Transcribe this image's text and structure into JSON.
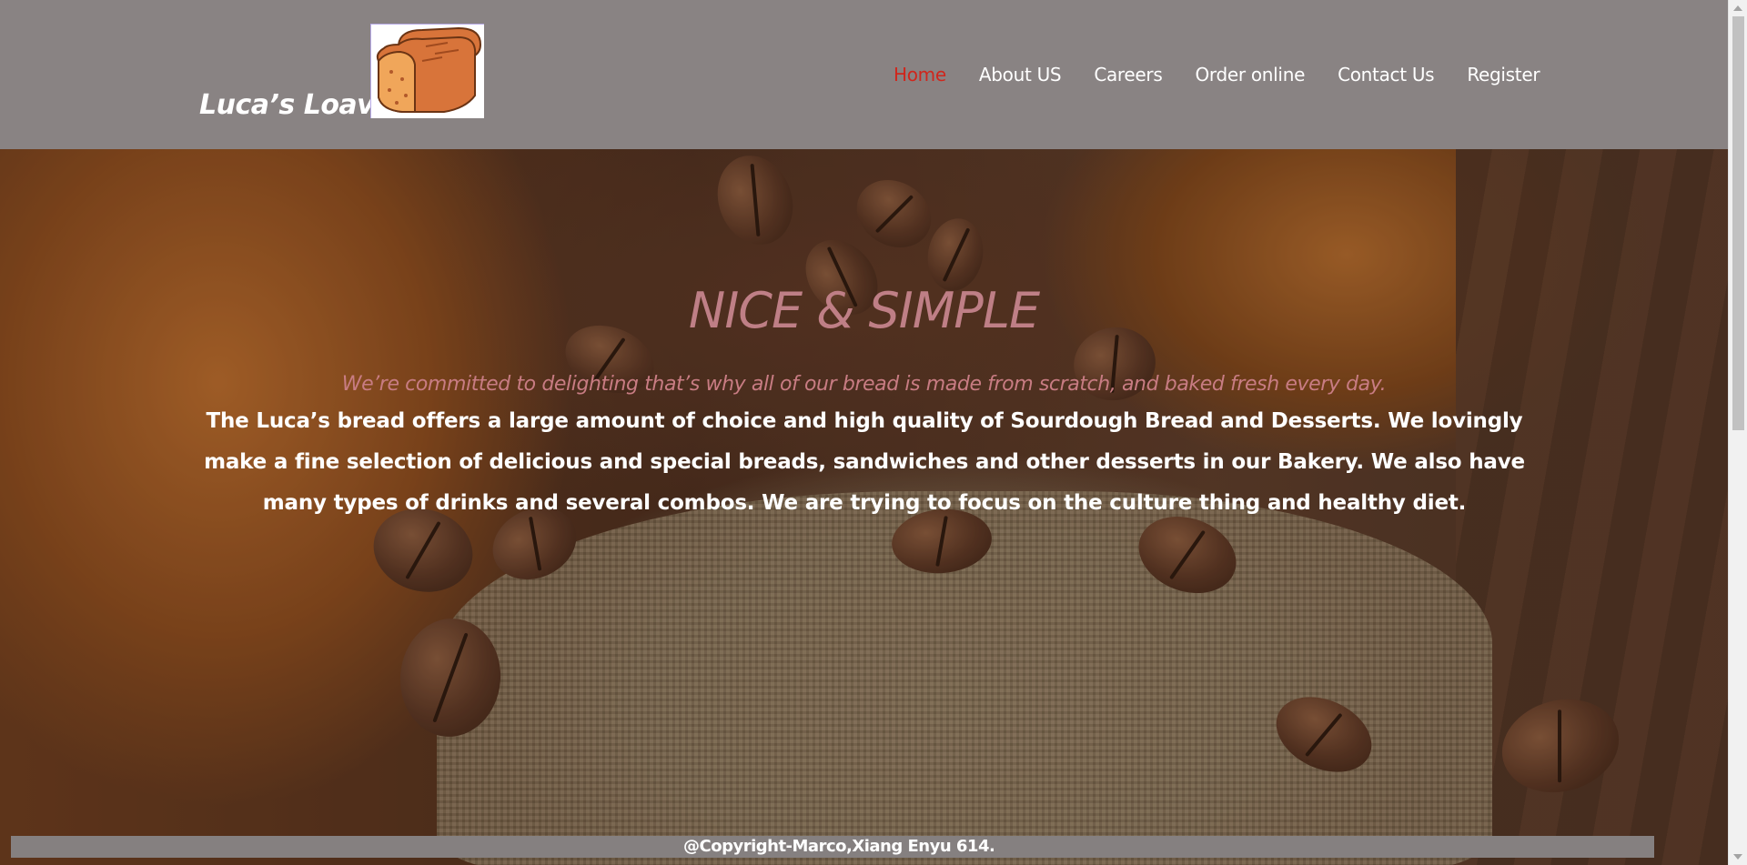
{
  "header": {
    "brand": "Luca’s Loaves",
    "logo_icon": "bread-loaf-icon",
    "nav": [
      {
        "label": "Home",
        "active": true
      },
      {
        "label": "About US",
        "active": false
      },
      {
        "label": "Careers",
        "active": false
      },
      {
        "label": "Order online",
        "active": false
      },
      {
        "label": "Contact Us",
        "active": false
      },
      {
        "label": "Register",
        "active": false
      }
    ]
  },
  "hero": {
    "headline": "NICE & SIMPLE",
    "tagline": "We’re committed to delighting that’s why all of our bread is made from scratch, and baked fresh every day.",
    "body": "The Luca’s bread offers a large amount of choice and high quality of Sourdough Bread and Desserts. We lovingly make a fine selection of delicious and special breads, sandwiches and other desserts in our Bakery. We also have many types of drinks and several combos. We are trying to focus on the culture thing and healthy diet."
  },
  "footer": {
    "copyright": "@Copyright-Marco,Xiang Enyu 614."
  },
  "colors": {
    "header_bg": "#898383",
    "nav_active": "#d0261c",
    "headline": "#bf7f86",
    "footer_bg": "#858080"
  }
}
